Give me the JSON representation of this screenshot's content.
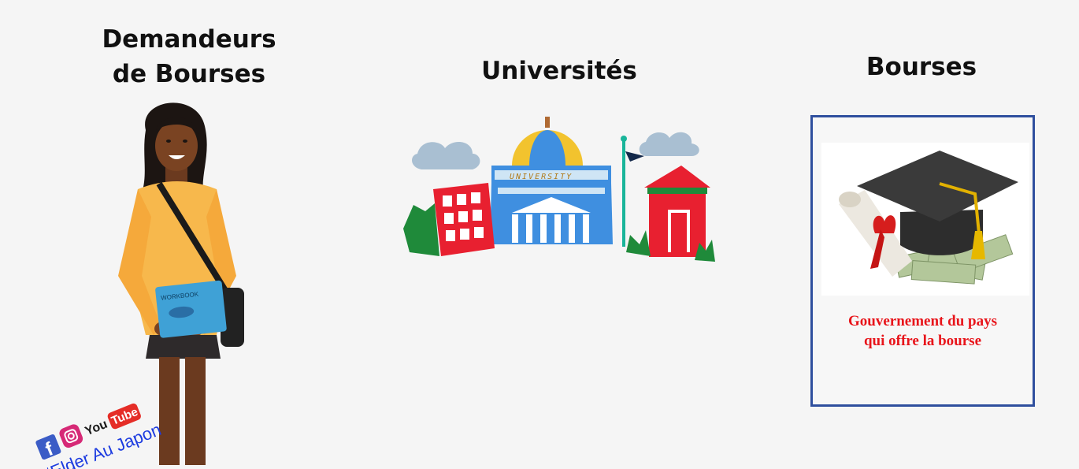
{
  "headings": {
    "demandeurs": "Demandeurs\nde Bourses",
    "universites": "Universités",
    "bourses": "Bourses"
  },
  "university_sign": "UNIVERSITY",
  "student": {
    "book_label": "WORKBOOK"
  },
  "bourse_card": {
    "caption_line1": "Gouvernement du pays",
    "caption_line2": "qui offre la bourse"
  },
  "watermark": {
    "platform_youtube": "YouTube",
    "handle": "#Elder Au Japon"
  },
  "colors": {
    "background": "#f5f5f5",
    "card_border": "#2f4f9e",
    "caption": "#e8141a",
    "watermark_text": "#1c3be0"
  },
  "icons": [
    "facebook-icon",
    "instagram-icon",
    "youtube-icon",
    "graduation-cap-icon",
    "university-icon",
    "student-illustration"
  ]
}
